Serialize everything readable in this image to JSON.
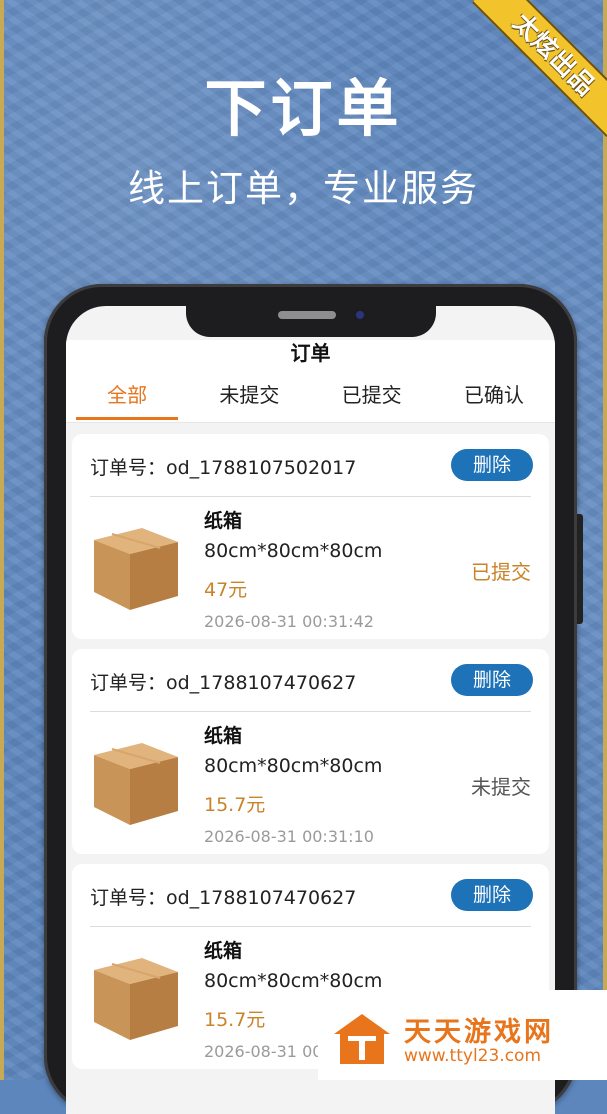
{
  "promo": {
    "title": "下订单",
    "subtitle": "线上订单，专业服务",
    "ribbon": "太炫出品"
  },
  "app": {
    "page_title": "订单",
    "tabs": [
      {
        "label": "全部",
        "active": true
      },
      {
        "label": "未提交",
        "active": false
      },
      {
        "label": "已提交",
        "active": false
      },
      {
        "label": "已确认",
        "active": false
      }
    ],
    "orders": [
      {
        "order_label": "订单号：od_1788107502017",
        "delete_label": "删除",
        "name": "纸箱",
        "size": "80cm*80cm*80cm",
        "price": "47元",
        "time": "2026-08-31 00:31:42",
        "status": "已提交"
      },
      {
        "order_label": "订单号：od_1788107470627",
        "delete_label": "删除",
        "name": "纸箱",
        "size": "80cm*80cm*80cm",
        "price": "15.7元",
        "time": "2026-08-31 00:31:10",
        "status": "未提交"
      },
      {
        "order_label": "订单号：od_1788107470627",
        "delete_label": "删除",
        "name": "纸箱",
        "size": "80cm*80cm*80cm",
        "price": "15.7元",
        "time": "2026-08-31 00",
        "status": ""
      }
    ]
  },
  "watermark": {
    "name": "天天游戏网",
    "url": "www.ttyl23.com"
  },
  "colors": {
    "accent": "#e8751b",
    "delete_button": "#1d72b8",
    "price": "#c98328",
    "background": "#5e87bf"
  }
}
